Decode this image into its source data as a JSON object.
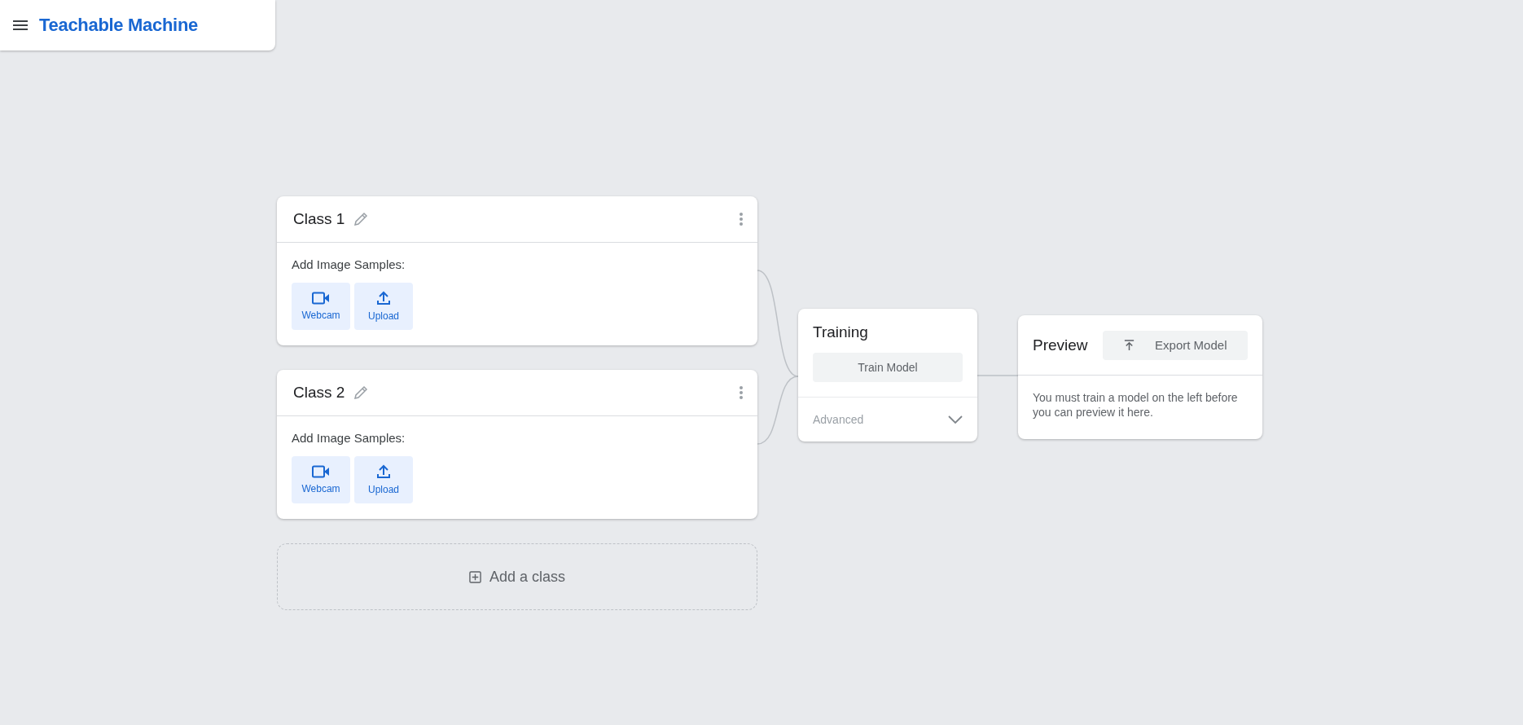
{
  "header": {
    "title": "Teachable Machine"
  },
  "classes": [
    {
      "name": "Class 1",
      "samples_label": "Add Image Samples:",
      "sources": [
        {
          "kind": "webcam",
          "label": "Webcam"
        },
        {
          "kind": "upload",
          "label": "Upload"
        }
      ]
    },
    {
      "name": "Class 2",
      "samples_label": "Add Image Samples:",
      "sources": [
        {
          "kind": "webcam",
          "label": "Webcam"
        },
        {
          "kind": "upload",
          "label": "Upload"
        }
      ]
    }
  ],
  "add_class": {
    "label": "Add a class"
  },
  "training": {
    "title": "Training",
    "button": "Train Model",
    "advanced": {
      "label": "Advanced",
      "expanded": false
    }
  },
  "preview": {
    "title": "Preview",
    "export_button": "Export Model",
    "message": "You must train a model on the left before you can preview it here."
  }
}
